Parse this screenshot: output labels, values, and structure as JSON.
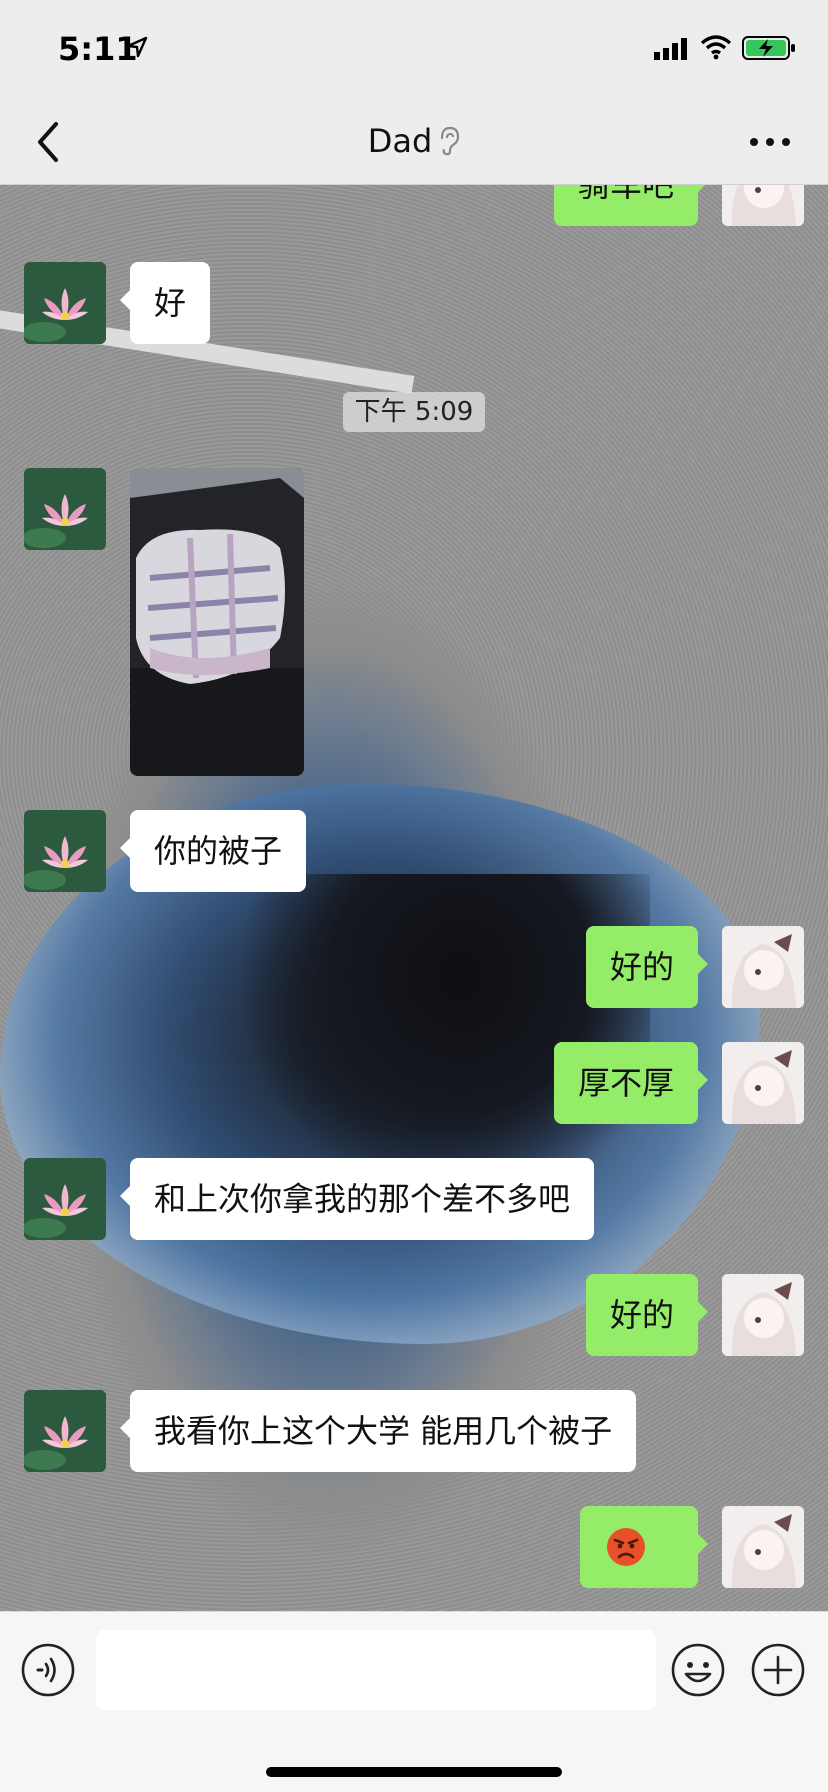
{
  "status_bar": {
    "time": "5:11"
  },
  "header": {
    "title": "Dad",
    "back_icon": "chevron-left-icon",
    "more_icon": "more-dots-icon",
    "mute_icon": "ear-icon"
  },
  "messages": [
    {
      "from": "me",
      "text": "骑车吧"
    },
    {
      "from": "dad",
      "text": "好"
    },
    {
      "type": "timestamp",
      "text": "下午 5:09"
    },
    {
      "from": "dad",
      "type": "image",
      "description": "photo"
    },
    {
      "from": "dad",
      "text": "你的被子"
    },
    {
      "from": "me",
      "text": "好的"
    },
    {
      "from": "me",
      "text": "厚不厚"
    },
    {
      "from": "dad",
      "text": "和上次你拿我的那个差不多吧"
    },
    {
      "from": "me",
      "text": "好的"
    },
    {
      "from": "dad",
      "text": "我看你上这个大学 能用几个被子"
    },
    {
      "from": "me",
      "type": "emoji",
      "emoji": "angry-face"
    }
  ],
  "input_bar": {
    "placeholder": "",
    "voice_icon": "voice-icon",
    "emoji_icon": "smiley-icon",
    "plus_icon": "plus-circle-icon"
  },
  "colors": {
    "out_bubble": "#95ec69",
    "in_bubble": "#ffffff",
    "bar": "#ededed"
  }
}
